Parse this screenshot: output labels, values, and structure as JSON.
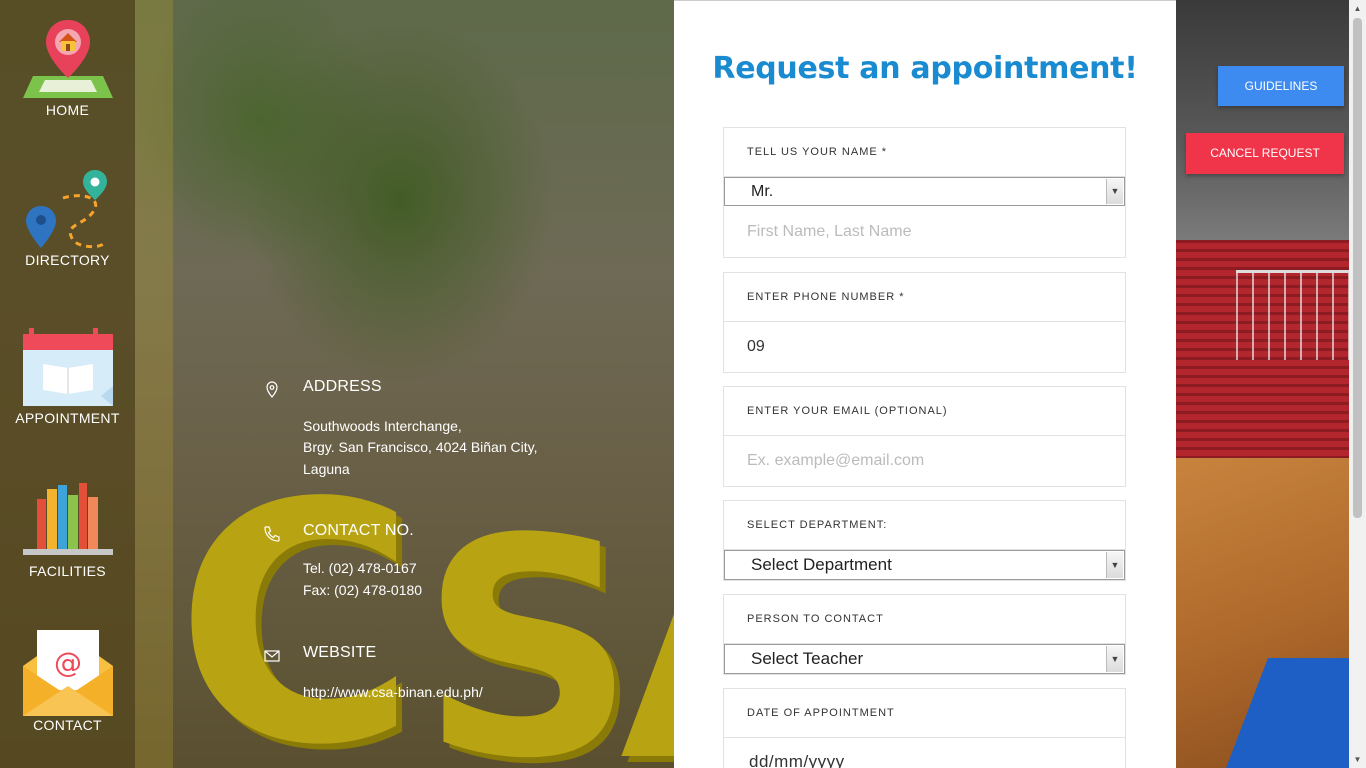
{
  "sidebar": {
    "items": [
      {
        "label": "HOME",
        "icon": "home-map-icon"
      },
      {
        "label": "DIRECTORY",
        "icon": "directory-map-icon"
      },
      {
        "label": "APPOINTMENT",
        "icon": "calendar-icon"
      },
      {
        "label": "FACILITIES",
        "icon": "books-shelf-icon"
      },
      {
        "label": "CONTACT",
        "icon": "mail-envelope-icon"
      }
    ]
  },
  "info": {
    "address": {
      "heading": "ADDRESS",
      "lines": [
        "Southwoods Interchange,",
        "Brgy. San Francisco, 4024 Biñan City,",
        "Laguna"
      ]
    },
    "contact": {
      "heading": "CONTACT NO.",
      "lines": [
        "Tel. (02) 478-0167",
        "Fax: (02) 478-0180"
      ]
    },
    "website": {
      "heading": "WEBSITE",
      "url": "http://www.csa-binan.edu.ph/"
    }
  },
  "background_text": {
    "letters": [
      "C",
      "S",
      "A"
    ]
  },
  "form": {
    "title": "Request an appointment!",
    "name": {
      "label": "TELL US YOUR NAME *",
      "salutation": "Mr.",
      "placeholder": "First Name, Last Name"
    },
    "phone": {
      "label": "ENTER PHONE NUMBER *",
      "value": "09"
    },
    "email": {
      "label": "ENTER YOUR EMAIL (OPTIONAL)",
      "placeholder": "Ex. example@email.com"
    },
    "department": {
      "label": "SELECT DEPARTMENT:",
      "selected": "Select Department"
    },
    "person": {
      "label": "PERSON TO CONTACT",
      "selected": "Select Teacher"
    },
    "date": {
      "label": "DATE OF APPOINTMENT",
      "placeholder": "dd/mm/yyyy"
    }
  },
  "buttons": {
    "guidelines": "GUIDELINES",
    "cancel": "CANCEL REQUEST"
  },
  "colors": {
    "title_blue": "#1a8bd0",
    "guidelines_button": "#3d8bf0",
    "cancel_button": "#f0344a"
  }
}
